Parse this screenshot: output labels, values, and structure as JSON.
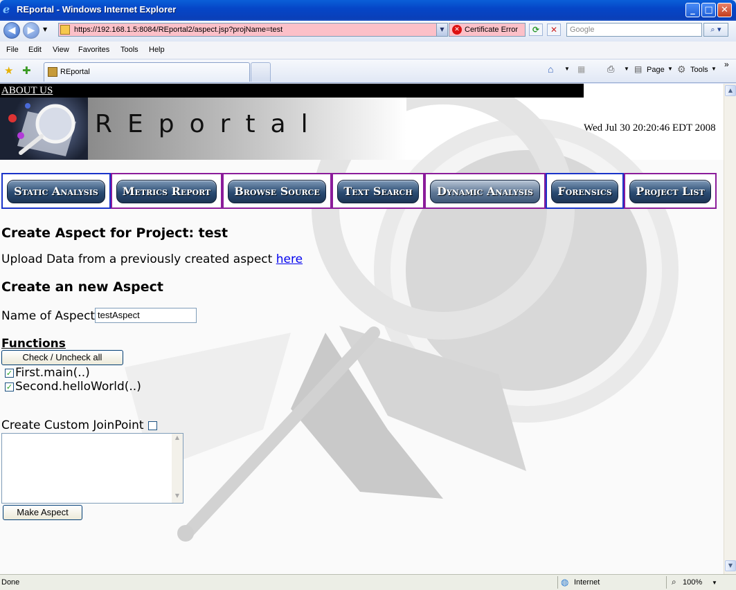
{
  "window": {
    "title": "REportal - Windows Internet Explorer"
  },
  "browser": {
    "url": "https://192.168.1.5:8084/REportal2/aspect.jsp?projName=test",
    "cert_error": "Certificate Error",
    "search_placeholder": "Google",
    "menu": [
      "File",
      "Edit",
      "View",
      "Favorites",
      "Tools",
      "Help"
    ],
    "tab_title": "REportal",
    "cmd_page": "Page",
    "cmd_tools": "Tools"
  },
  "page": {
    "about_link": "ABOUT US",
    "banner_text": "REportal",
    "datetime": "Wed Jul 30 20:20:46 EDT 2008",
    "nav": [
      {
        "label": "Static Analysis"
      },
      {
        "label": "Metrics Report"
      },
      {
        "label": "Browse Source"
      },
      {
        "label": "Text Search"
      },
      {
        "label": "Dynamic Analysis"
      },
      {
        "label": "Forensics"
      },
      {
        "label": "Project List"
      }
    ],
    "create_heading": "Create Aspect for Project: test",
    "upload_text": "Upload Data from a previously created aspect",
    "upload_link": "here",
    "new_aspect_heading": "Create an new Aspect",
    "aspect_name_label": "Name of Aspect",
    "aspect_name_value": "testAspect",
    "functions_heading": "Functions",
    "check_all_label": "Check / Uncheck all",
    "functions": [
      {
        "name": "First.main(..)",
        "checked": true
      },
      {
        "name": "Second.helloWorld(..)",
        "checked": true
      }
    ],
    "custom_joinpoint_label": "Create Custom JoinPoint",
    "custom_joinpoint_checked": false,
    "make_aspect_label": "Make Aspect"
  },
  "status": {
    "left": "Done",
    "zone": "Internet",
    "zoom": "100%"
  }
}
